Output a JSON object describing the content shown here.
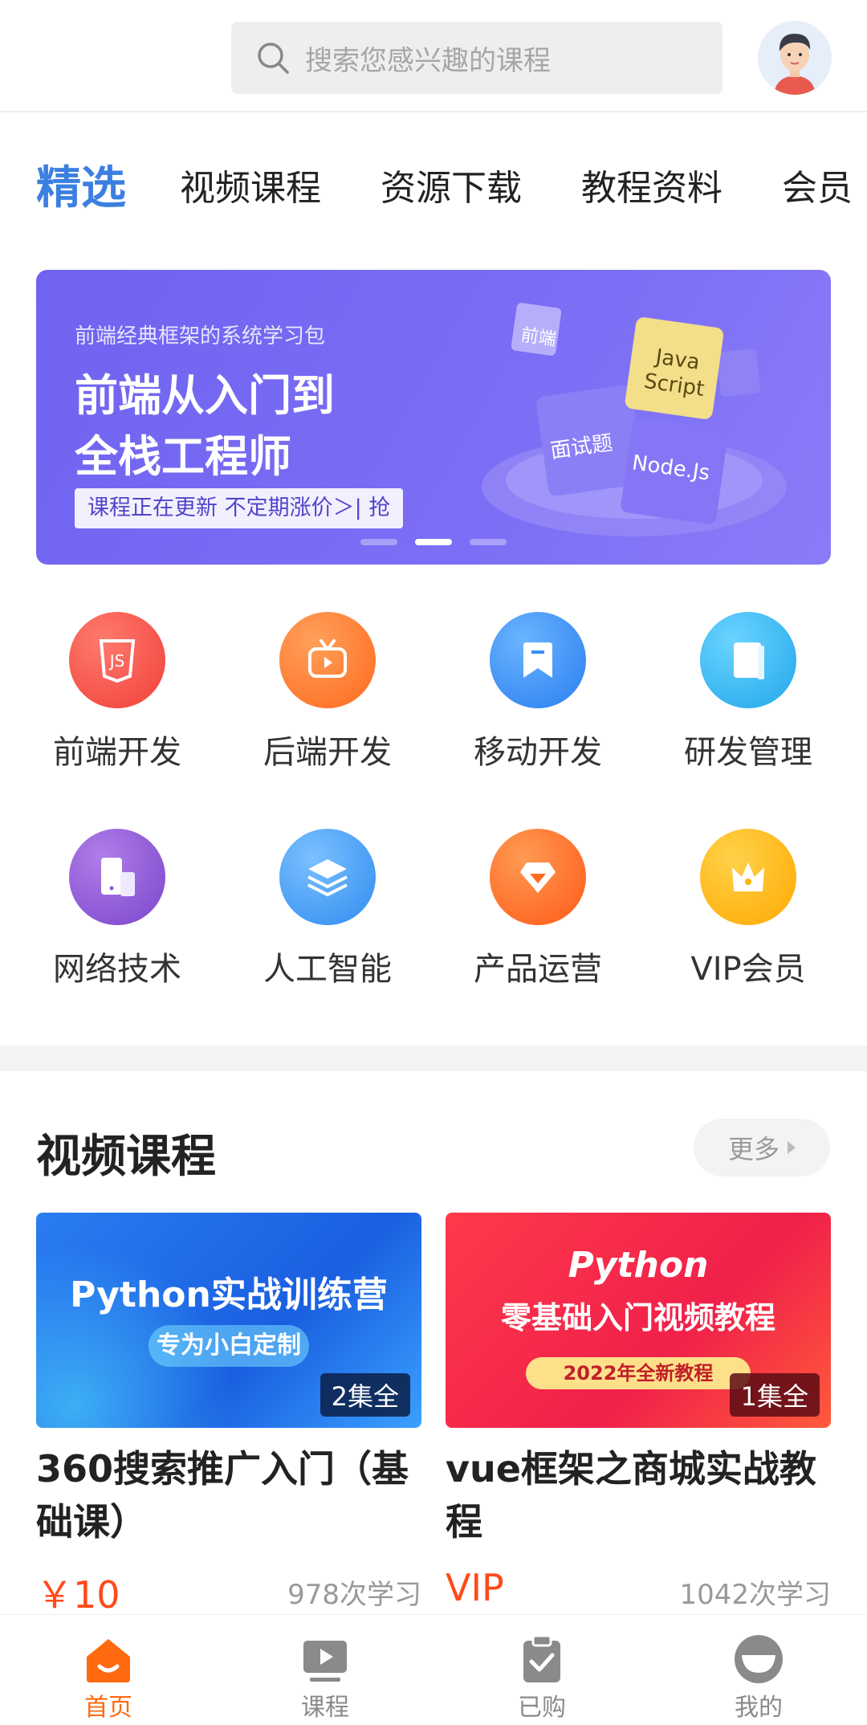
{
  "search": {
    "placeholder": "搜索您感兴趣的课程"
  },
  "tabs": [
    {
      "label": "精选",
      "active": true
    },
    {
      "label": "视频课程"
    },
    {
      "label": "资源下载"
    },
    {
      "label": "教程资料"
    },
    {
      "label": "会员"
    }
  ],
  "banner": {
    "subtitle": "前端经典框架的系统学习包",
    "title_line1": "前端从入门到",
    "title_line2": "全栈工程师",
    "cta": "课程正在更新 不定期涨价＞| 抢",
    "tiles": [
      "前端",
      "Java Script",
      "面试题",
      "Node.Js"
    ]
  },
  "categories": [
    {
      "label": "前端开发",
      "icon": "js-icon",
      "color": "#f4524a"
    },
    {
      "label": "后端开发",
      "icon": "tv-icon",
      "color": "#ff7a2e"
    },
    {
      "label": "移动开发",
      "icon": "bookmark-icon",
      "color": "#3a8ff5"
    },
    {
      "label": "研发管理",
      "icon": "book-icon",
      "color": "#2fb4ee"
    },
    {
      "label": "网络技术",
      "icon": "devices-icon",
      "color": "#8a55d8"
    },
    {
      "label": "人工智能",
      "icon": "layers-icon",
      "color": "#3c9df5"
    },
    {
      "label": "产品运营",
      "icon": "diamond-icon",
      "color": "#ff6a20"
    },
    {
      "label": "VIP会员",
      "icon": "crown-icon",
      "color": "#ffb400"
    }
  ],
  "section": {
    "title": "视频课程",
    "more": "更多"
  },
  "courses": [
    {
      "thumb_title": "Python实战训练营",
      "thumb_sub": "专为小白定制",
      "badge": "2集全",
      "title": "360搜索推广入门（基础课）",
      "price": "￥10",
      "count": "978次学习"
    },
    {
      "thumb_title": "Python",
      "thumb_line2": "零基础入门视频教程",
      "thumb_sub": "2022年全新教程",
      "badge": "1集全",
      "title": "vue框架之商城实战教程",
      "price": "VIP",
      "count": "1042次学习"
    }
  ],
  "nav": [
    {
      "label": "首页",
      "icon": "home-icon",
      "active": true
    },
    {
      "label": "课程",
      "icon": "video-icon"
    },
    {
      "label": "已购",
      "icon": "clipboard-check-icon"
    },
    {
      "label": "我的",
      "icon": "profile-icon"
    }
  ],
  "colors": {
    "accent": "#3b7fe0",
    "orange": "#ff6a10",
    "price": "#ff4a1a"
  }
}
